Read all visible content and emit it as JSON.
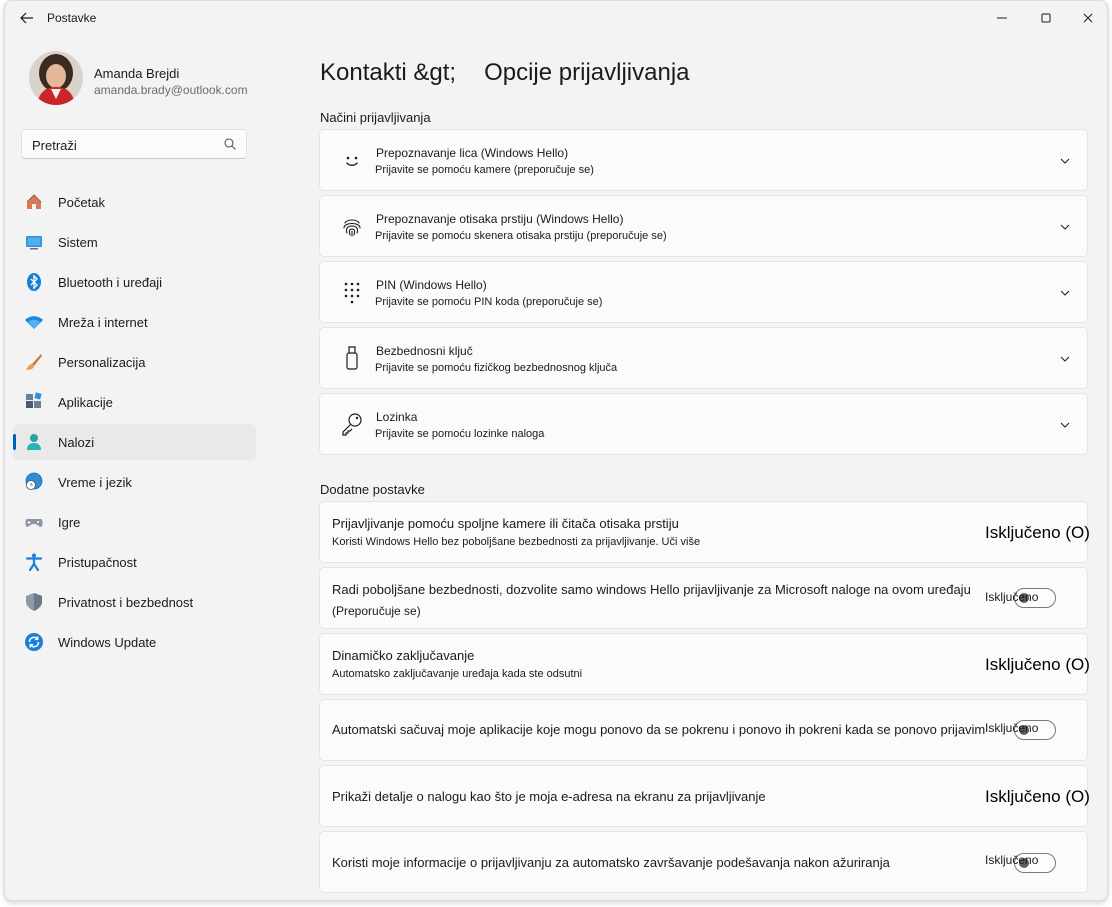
{
  "window": {
    "title": "Postavke"
  },
  "profile": {
    "name": "Amanda Brejdi",
    "email": "amanda.brady@outlook.com"
  },
  "search": {
    "placeholder": "Pretraži"
  },
  "sidebar": {
    "items": [
      {
        "label": "Početak",
        "icon": "home-icon"
      },
      {
        "label": "Sistem",
        "icon": "monitor-icon"
      },
      {
        "label": "Bluetooth i uređaji",
        "icon": "bluetooth-icon"
      },
      {
        "label": "Mreža i internet",
        "icon": "wifi-icon"
      },
      {
        "label": "Personalizacija",
        "icon": "brush-icon"
      },
      {
        "label": "Aplikacije",
        "icon": "apps-icon"
      },
      {
        "label": "Nalozi",
        "icon": "person-icon",
        "active": true
      },
      {
        "label": "Vreme i jezik",
        "icon": "globe-clock-icon"
      },
      {
        "label": "Igre",
        "icon": "gamepad-icon"
      },
      {
        "label": "Pristupačnost",
        "icon": "accessibility-icon"
      },
      {
        "label": "Privatnost i bezbednost",
        "icon": "shield-icon"
      },
      {
        "label": "Windows Update",
        "icon": "update-icon"
      }
    ]
  },
  "header": {
    "crumb1": "Kontakti &gt;",
    "crumb2": "Opcije prijavljivanja"
  },
  "signin_methods": {
    "heading": "Načini prijavljivanja",
    "items": [
      {
        "title": "Prepoznavanje lica (Windows Hello)",
        "subtitle": "Prijavite se pomoću kamere (preporučuje se)",
        "icon": "face-icon"
      },
      {
        "title": "Prepoznavanje otisaka prstiju (Windows Hello)",
        "subtitle": "Prijavite se pomoću skenera otisaka prstiju (preporučuje se)",
        "icon": "fingerprint-icon"
      },
      {
        "title": "PIN (Windows Hello)",
        "subtitle": "Prijavite se pomoću PIN koda (preporučuje se)",
        "icon": "pin-keypad-icon"
      },
      {
        "title": "Bezbednosni ključ",
        "subtitle": "Prijavite se pomoću fizičkog bezbednosnog ključa",
        "icon": "usb-key-icon"
      },
      {
        "title": "Lozinka",
        "subtitle": "Prijavite se pomoću lozinke naloga",
        "icon": "key-icon"
      }
    ]
  },
  "additional": {
    "heading": "Dodatne postavke",
    "items": [
      {
        "title": "Prijavljivanje pomoću spoljne kamere ili čitača otisaka prstiju",
        "subtitle": "Koristi Windows Hello bez poboljšane bezbednosti za prijavljivanje. Uči više",
        "state": "Isključeno (O)",
        "style": "text"
      },
      {
        "title": "Radi poboljšane bezbednosti, dozvolite samo windows Hello prijavljivanje za Microsoft naloge na ovom uređaju",
        "subtitle": "(Preporučuje se)",
        "state": "Isključeno",
        "style": "toggle",
        "value": false
      },
      {
        "title": "Dinamičko zaključavanje",
        "subtitle": "Automatsko zaključavanje uređaja kada ste odsutni",
        "state": "Isključeno (O)",
        "style": "text"
      },
      {
        "title": "Automatski sačuvaj moje aplikacije koje mogu ponovo da se pokrenu i ponovo ih pokreni kada se ponovo prijavim",
        "state": "Isključeno",
        "style": "toggle",
        "value": false
      },
      {
        "title": "Prikaži detalje o nalogu kao što je moja e-adresa na ekranu za prijavljivanje",
        "state": "Isključeno (O)",
        "style": "text"
      },
      {
        "title": "Koristi moje informacije o prijavljivanju za automatsko završavanje podešavanja nakon ažuriranja",
        "state": "Isključeno",
        "style": "toggle",
        "value": false
      }
    ]
  },
  "colors": {
    "accent": "#005fb8",
    "window_bg": "#f3f3f3",
    "card_bg": "#fbfbfb"
  }
}
